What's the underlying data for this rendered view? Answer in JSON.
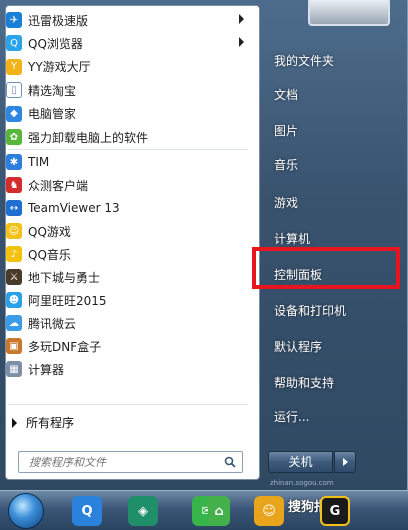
{
  "programs": [
    {
      "label": "迅雷极速版",
      "icon": "thunder-icon",
      "color": "#1a7fd6",
      "glyph": "✈",
      "arrow": true
    },
    {
      "label": "QQ浏览器",
      "icon": "qq-browser-icon",
      "color": "#2aa3e8",
      "glyph": "Q",
      "arrow": true
    },
    {
      "label": "YY游戏大厅",
      "icon": "yy-game-icon",
      "color": "#f2b21a",
      "glyph": "Y",
      "arrow": false
    },
    {
      "label": "精选淘宝",
      "icon": "taobao-icon",
      "color": "#ffffff",
      "glyph": "▯",
      "arrow": false
    },
    {
      "label": "电脑管家",
      "icon": "pc-manager-icon",
      "color": "#2f86e0",
      "glyph": "◆",
      "arrow": false
    },
    {
      "label": "强力卸载电脑上的软件",
      "icon": "uninstall-icon",
      "color": "#58b73a",
      "glyph": "✿",
      "arrow": false
    }
  ],
  "programs2": [
    {
      "label": "TIM",
      "icon": "tim-icon",
      "color": "#2c7fdc",
      "glyph": "✱"
    },
    {
      "label": "众测客户端",
      "icon": "zhongce-icon",
      "color": "#d42b2b",
      "glyph": "♞"
    },
    {
      "label": "TeamViewer 13",
      "icon": "teamviewer-icon",
      "color": "#1e6fd1",
      "glyph": "↔"
    },
    {
      "label": "QQ游戏",
      "icon": "qq-game-icon",
      "color": "#f2c21a",
      "glyph": "☺"
    },
    {
      "label": "QQ音乐",
      "icon": "qq-music-icon",
      "color": "#f4c20d",
      "glyph": "♪"
    },
    {
      "label": "地下城与勇士",
      "icon": "dnf-icon",
      "color": "#4a3a2a",
      "glyph": "⚔"
    },
    {
      "label": "阿里旺旺2015",
      "icon": "aliwangwang-icon",
      "color": "#2aa0e8",
      "glyph": "☻"
    },
    {
      "label": "腾讯微云",
      "icon": "weiyun-icon",
      "color": "#3a9be6",
      "glyph": "☁"
    },
    {
      "label": "多玩DNF盒子",
      "icon": "dnf-box-icon",
      "color": "#c8782a",
      "glyph": "▣"
    },
    {
      "label": "计算器",
      "icon": "calculator-icon",
      "color": "#7c8fa6",
      "glyph": "▦"
    }
  ],
  "all_programs_label": "所有程序",
  "search": {
    "placeholder": "搜索程序和文件"
  },
  "right_items": [
    "我的文件夹",
    "文档",
    "图片",
    "音乐",
    "游戏",
    "计算机",
    "控制面板",
    "设备和打印机",
    "默认程序",
    "帮助和支持",
    "运行..."
  ],
  "shutdown_label": "关机",
  "taskbar": {
    "watermark": "搜狗指南",
    "watermark_sub": "zhinan.sogou.com"
  }
}
